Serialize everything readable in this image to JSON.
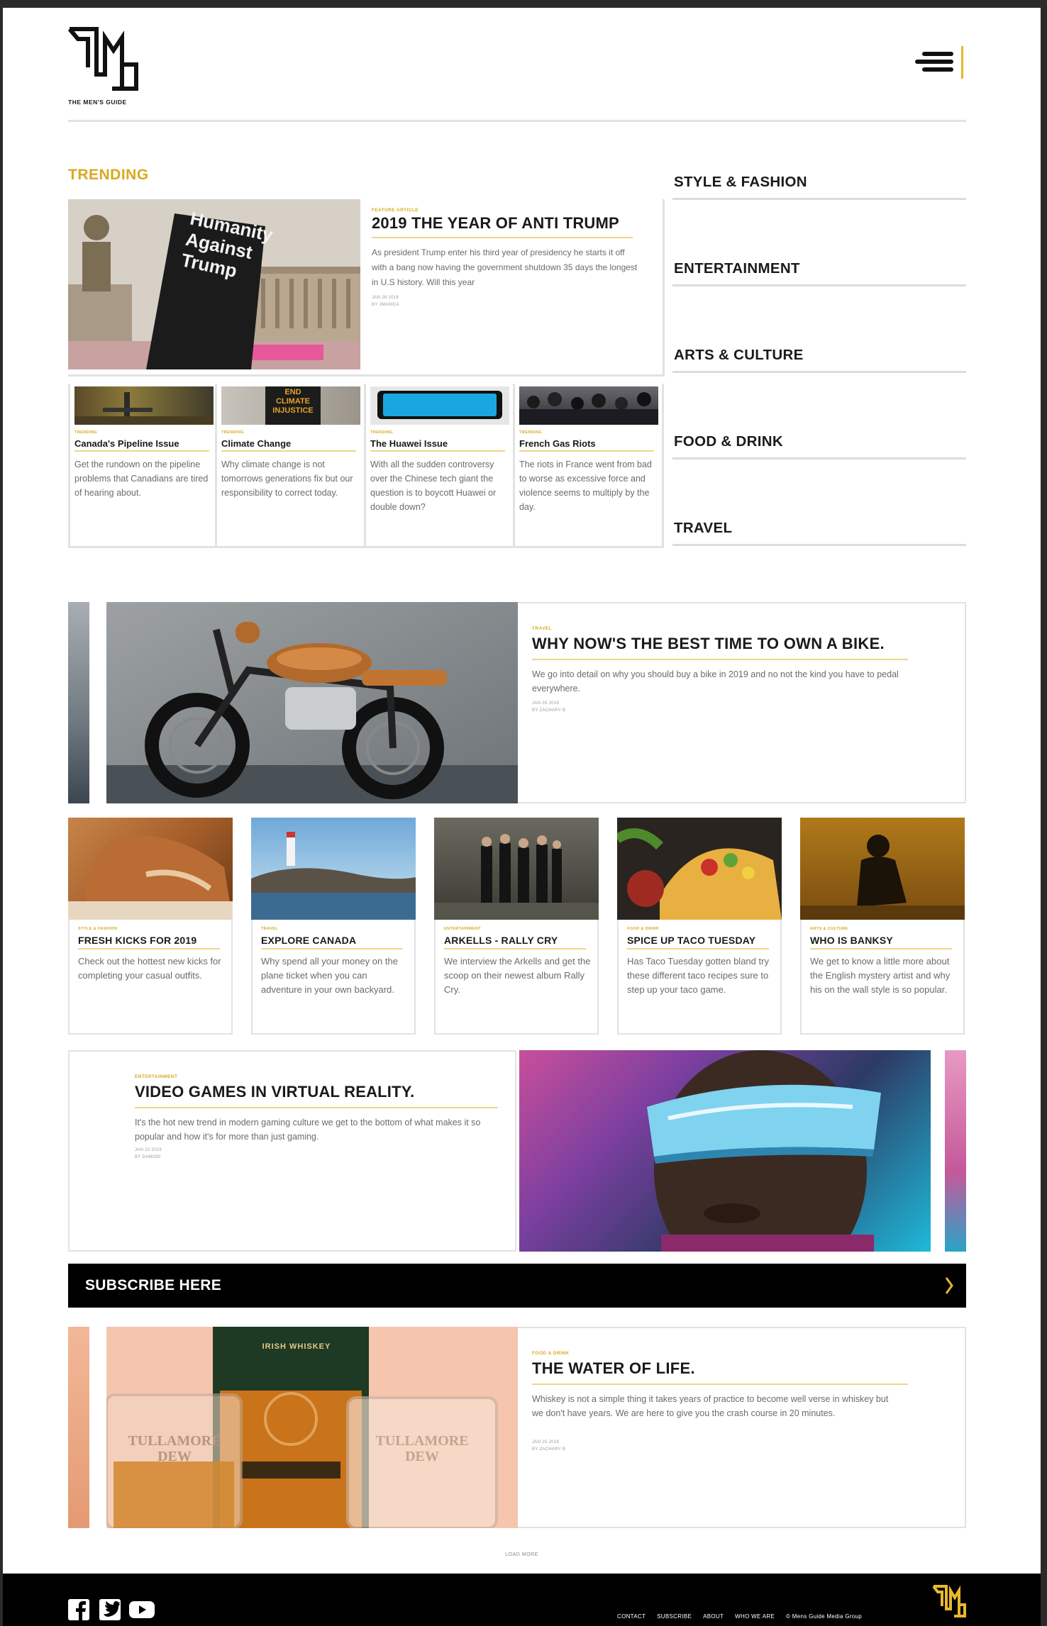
{
  "brand": {
    "name": "THE MEN'S GUIDE"
  },
  "trending": {
    "label": "TRENDING",
    "feature": {
      "kicker": "FEATURE ARTICLE",
      "title": "2019 THE YEAR OF ANTI TRUMP",
      "excerpt": "As president Trump enter his third year of presidency he starts it off with a bang now having the government shutdown 35 days the longest in U.S history. Will this year",
      "date": "JAN 26 2019",
      "author": "BY JMANICA",
      "sign_text": "Humanity Against Trump"
    },
    "minis": [
      {
        "kicker": "TRENDING",
        "title": "Canada's Pipeline Issue",
        "excerpt": "Get the rundown on the pipeline problems that Canadians are tired of hearing about."
      },
      {
        "kicker": "TRENDING",
        "title": "Climate Change",
        "excerpt": "Why climate change is not tomorrows generations fix but our responsibility to correct today.",
        "sign_text": "END CLIMATE INJUSTICE"
      },
      {
        "kicker": "TRENDING",
        "title": "The Huawei Issue",
        "excerpt": "With all the sudden controversy over the Chinese tech giant the question is to boycott Huawei or double down?"
      },
      {
        "kicker": "TRENDING",
        "title": "French Gas Riots",
        "excerpt": "The riots in France went from bad to worse as excessive force and violence seems to multiply by the day."
      }
    ]
  },
  "categories": [
    "STYLE & FASHION",
    "ENTERTAINMENT",
    "ARTS & CULTURE",
    "FOOD & DRINK",
    "TRAVEL"
  ],
  "bike": {
    "kicker": "TRAVEL",
    "title": "WHY NOW'S THE BEST TIME TO OWN A BIKE.",
    "excerpt": "We go into detail on why you should buy a bike in 2019 and no not the kind you have to pedal everywhere.",
    "date": "JAN 26 2019",
    "author": "BY ZACHARY B"
  },
  "cards": [
    {
      "kicker": "STYLE & FASHION",
      "title": "FRESH KICKS FOR 2019",
      "excerpt": "Check out the hottest new kicks for completing your casual outfits."
    },
    {
      "kicker": "TRAVEL",
      "title": "EXPLORE CANADA",
      "excerpt": "Why spend all your money on the plane ticket when you can adventure in your own backyard."
    },
    {
      "kicker": "ENTERTAINMENT",
      "title": "ARKELLS - RALLY CRY",
      "excerpt": "We interview the Arkells and get the scoop on their newest album Rally Cry."
    },
    {
      "kicker": "FOOD & DRINK",
      "title": "SPICE UP TACO TUESDAY",
      "excerpt": "Has Taco Tuesday gotten bland try these different taco recipes sure to step up your taco game."
    },
    {
      "kicker": "ARTS & CULTURE",
      "title": "WHO IS BANKSY",
      "excerpt": "We get to know a little more about the English mystery artist and why his on the wall style is so popular."
    }
  ],
  "vr": {
    "kicker": "ENTERTAINMENT",
    "title": "VIDEO GAMES IN VIRTUAL REALITY.",
    "excerpt": "It's the hot new trend in modern gaming culture we get to the bottom of what makes it so popular and how it's for more than just gaming.",
    "date": "JAN 22 2019",
    "author": "BY DAMION"
  },
  "subscribe": {
    "label": "SUBSCRIBE HERE"
  },
  "whiskey": {
    "kicker": "FOOD & DRINK",
    "title": "THE WATER OF LIFE.",
    "excerpt": "Whiskey is not a simple thing it takes years of practice to become well verse in whiskey but we don't have years. We are here to give you the crash course in 20 minutes.",
    "date": "JAN 25 2019",
    "author": "BY ZACHARY B",
    "glass_text": "TULLAMORE DEW",
    "bottle_text": "IRISH WHISKEY"
  },
  "load_more": "LOAD MORE",
  "footer": {
    "links": [
      "CONTACT",
      "SUBSCRIBE",
      "ABOUT",
      "WHO WE ARE"
    ],
    "copyright": "© Mens Guide Media Group"
  },
  "colors": {
    "accent": "#e8b82e",
    "kicker": "#d9a91f",
    "rule": "#e2e2e2",
    "footer_bg": "#000000"
  },
  "icons": [
    "menu-icon",
    "facebook-icon",
    "twitter-icon",
    "youtube-icon",
    "chevron-right-icon"
  ]
}
